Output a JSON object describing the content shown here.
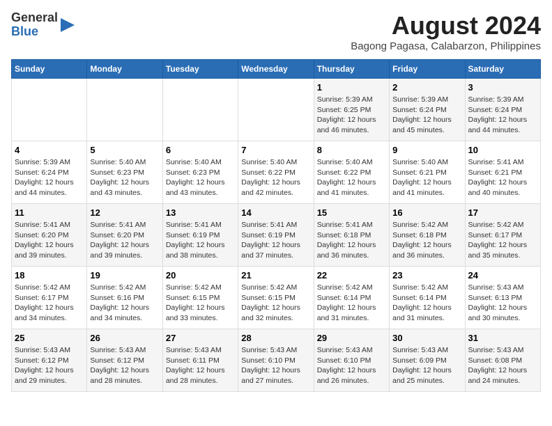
{
  "logo": {
    "text_general": "General",
    "text_blue": "Blue"
  },
  "title": "August 2024",
  "subtitle": "Bagong Pagasa, Calabarzon, Philippines",
  "days_of_week": [
    "Sunday",
    "Monday",
    "Tuesday",
    "Wednesday",
    "Thursday",
    "Friday",
    "Saturday"
  ],
  "weeks": [
    [
      {
        "day": "",
        "content": ""
      },
      {
        "day": "",
        "content": ""
      },
      {
        "day": "",
        "content": ""
      },
      {
        "day": "",
        "content": ""
      },
      {
        "day": "1",
        "content": "Sunrise: 5:39 AM\nSunset: 6:25 PM\nDaylight: 12 hours\nand 46 minutes."
      },
      {
        "day": "2",
        "content": "Sunrise: 5:39 AM\nSunset: 6:24 PM\nDaylight: 12 hours\nand 45 minutes."
      },
      {
        "day": "3",
        "content": "Sunrise: 5:39 AM\nSunset: 6:24 PM\nDaylight: 12 hours\nand 44 minutes."
      }
    ],
    [
      {
        "day": "4",
        "content": "Sunrise: 5:39 AM\nSunset: 6:24 PM\nDaylight: 12 hours\nand 44 minutes."
      },
      {
        "day": "5",
        "content": "Sunrise: 5:40 AM\nSunset: 6:23 PM\nDaylight: 12 hours\nand 43 minutes."
      },
      {
        "day": "6",
        "content": "Sunrise: 5:40 AM\nSunset: 6:23 PM\nDaylight: 12 hours\nand 43 minutes."
      },
      {
        "day": "7",
        "content": "Sunrise: 5:40 AM\nSunset: 6:22 PM\nDaylight: 12 hours\nand 42 minutes."
      },
      {
        "day": "8",
        "content": "Sunrise: 5:40 AM\nSunset: 6:22 PM\nDaylight: 12 hours\nand 41 minutes."
      },
      {
        "day": "9",
        "content": "Sunrise: 5:40 AM\nSunset: 6:21 PM\nDaylight: 12 hours\nand 41 minutes."
      },
      {
        "day": "10",
        "content": "Sunrise: 5:41 AM\nSunset: 6:21 PM\nDaylight: 12 hours\nand 40 minutes."
      }
    ],
    [
      {
        "day": "11",
        "content": "Sunrise: 5:41 AM\nSunset: 6:20 PM\nDaylight: 12 hours\nand 39 minutes."
      },
      {
        "day": "12",
        "content": "Sunrise: 5:41 AM\nSunset: 6:20 PM\nDaylight: 12 hours\nand 39 minutes."
      },
      {
        "day": "13",
        "content": "Sunrise: 5:41 AM\nSunset: 6:19 PM\nDaylight: 12 hours\nand 38 minutes."
      },
      {
        "day": "14",
        "content": "Sunrise: 5:41 AM\nSunset: 6:19 PM\nDaylight: 12 hours\nand 37 minutes."
      },
      {
        "day": "15",
        "content": "Sunrise: 5:41 AM\nSunset: 6:18 PM\nDaylight: 12 hours\nand 36 minutes."
      },
      {
        "day": "16",
        "content": "Sunrise: 5:42 AM\nSunset: 6:18 PM\nDaylight: 12 hours\nand 36 minutes."
      },
      {
        "day": "17",
        "content": "Sunrise: 5:42 AM\nSunset: 6:17 PM\nDaylight: 12 hours\nand 35 minutes."
      }
    ],
    [
      {
        "day": "18",
        "content": "Sunrise: 5:42 AM\nSunset: 6:17 PM\nDaylight: 12 hours\nand 34 minutes."
      },
      {
        "day": "19",
        "content": "Sunrise: 5:42 AM\nSunset: 6:16 PM\nDaylight: 12 hours\nand 34 minutes."
      },
      {
        "day": "20",
        "content": "Sunrise: 5:42 AM\nSunset: 6:15 PM\nDaylight: 12 hours\nand 33 minutes."
      },
      {
        "day": "21",
        "content": "Sunrise: 5:42 AM\nSunset: 6:15 PM\nDaylight: 12 hours\nand 32 minutes."
      },
      {
        "day": "22",
        "content": "Sunrise: 5:42 AM\nSunset: 6:14 PM\nDaylight: 12 hours\nand 31 minutes."
      },
      {
        "day": "23",
        "content": "Sunrise: 5:42 AM\nSunset: 6:14 PM\nDaylight: 12 hours\nand 31 minutes."
      },
      {
        "day": "24",
        "content": "Sunrise: 5:43 AM\nSunset: 6:13 PM\nDaylight: 12 hours\nand 30 minutes."
      }
    ],
    [
      {
        "day": "25",
        "content": "Sunrise: 5:43 AM\nSunset: 6:12 PM\nDaylight: 12 hours\nand 29 minutes."
      },
      {
        "day": "26",
        "content": "Sunrise: 5:43 AM\nSunset: 6:12 PM\nDaylight: 12 hours\nand 28 minutes."
      },
      {
        "day": "27",
        "content": "Sunrise: 5:43 AM\nSunset: 6:11 PM\nDaylight: 12 hours\nand 28 minutes."
      },
      {
        "day": "28",
        "content": "Sunrise: 5:43 AM\nSunset: 6:10 PM\nDaylight: 12 hours\nand 27 minutes."
      },
      {
        "day": "29",
        "content": "Sunrise: 5:43 AM\nSunset: 6:10 PM\nDaylight: 12 hours\nand 26 minutes."
      },
      {
        "day": "30",
        "content": "Sunrise: 5:43 AM\nSunset: 6:09 PM\nDaylight: 12 hours\nand 25 minutes."
      },
      {
        "day": "31",
        "content": "Sunrise: 5:43 AM\nSunset: 6:08 PM\nDaylight: 12 hours\nand 24 minutes."
      }
    ]
  ]
}
